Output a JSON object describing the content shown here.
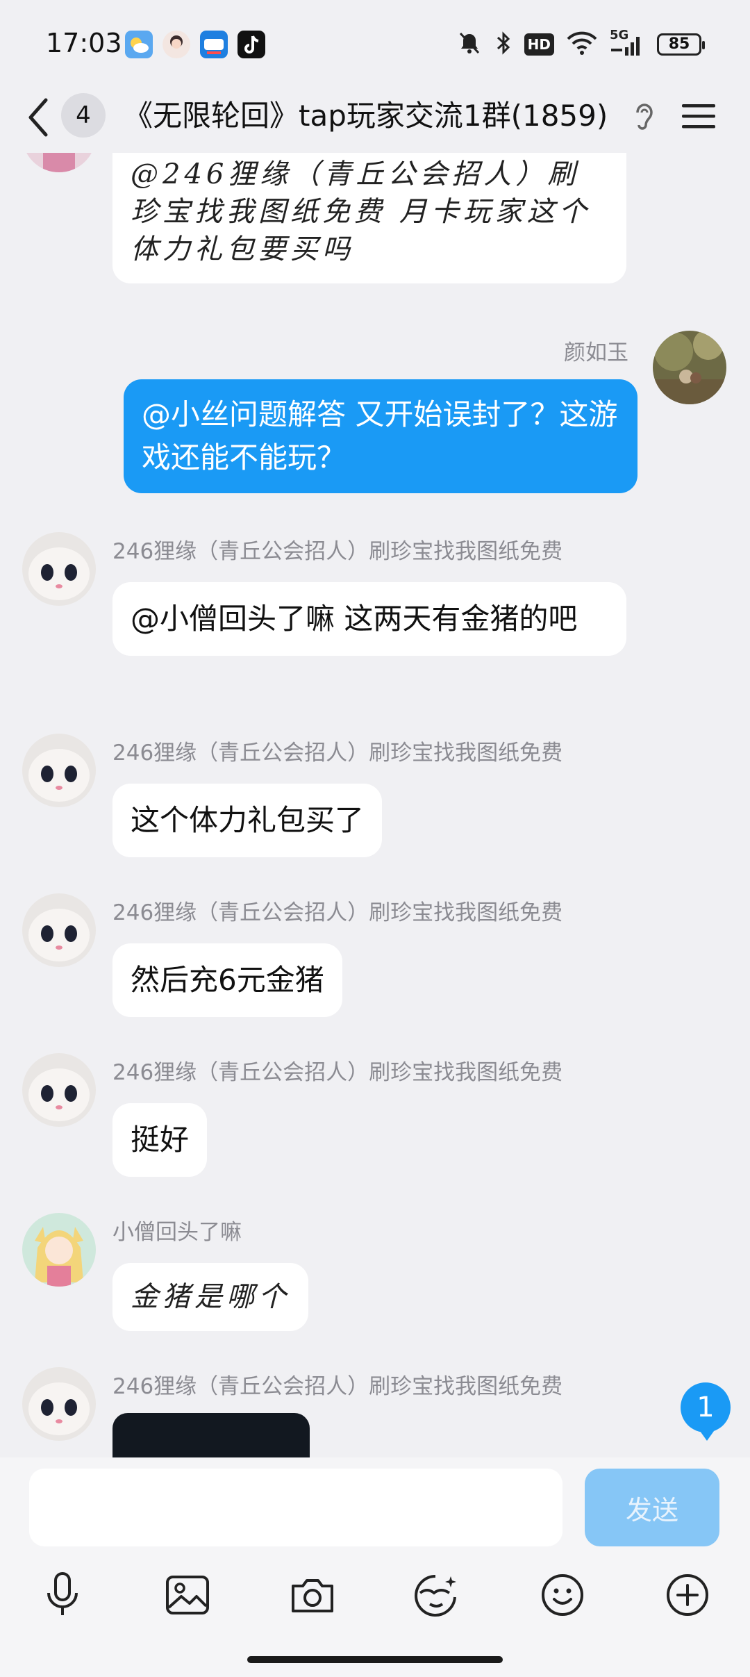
{
  "status_bar": {
    "time": "17:03",
    "battery": "85",
    "network": "5G",
    "hd": "HD",
    "icons": [
      "weather-app-icon",
      "avatar-app-icon",
      "browser-app-icon",
      "tiktok-app-icon",
      "mute-icon",
      "bluetooth-icon",
      "hd-icon",
      "wifi-icon",
      "signal-icon",
      "battery-icon"
    ]
  },
  "header": {
    "unread_count": "4",
    "title": "《无限轮回》tap玩家交流1群(1859)"
  },
  "messages": [
    {
      "sender": "",
      "text": "@246狸缘（青丘公会招人）刷珍宝找我图纸免费 月卡玩家这个体力礼包要买吗",
      "style": "script",
      "mine": false
    },
    {
      "sender": "颜如玉",
      "text": "@小丝问题解答 又开始误封了？这游戏还能不能玩？",
      "mine": true
    },
    {
      "sender": "246狸缘（青丘公会招人）刷珍宝找我图纸免费",
      "text": "@小僧回头了嘛 这两天有金猪的吧",
      "mine": false
    },
    {
      "sender": "246狸缘（青丘公会招人）刷珍宝找我图纸免费",
      "text": "这个体力礼包买了",
      "mine": false
    },
    {
      "sender": "246狸缘（青丘公会招人）刷珍宝找我图纸免费",
      "text": "然后充6元金猪",
      "mine": false
    },
    {
      "sender": "246狸缘（青丘公会招人）刷珍宝找我图纸免费",
      "text": "挺好",
      "mine": false
    },
    {
      "sender": "小僧回头了嘛",
      "text": "金猪是哪个",
      "style": "script",
      "mine": false
    },
    {
      "sender": "246狸缘（青丘公会招人）刷珍宝找我图纸免费",
      "text": "",
      "mine": false,
      "type": "image"
    }
  ],
  "new_message_count": "1",
  "input": {
    "value": "",
    "placeholder": "",
    "send_label": "发送"
  },
  "toolbar": [
    "mic-icon",
    "image-icon",
    "camera-icon",
    "sticker-icon",
    "emoji-icon",
    "plus-icon"
  ],
  "colors": {
    "accent": "#1a9af5",
    "background": "#f0f0f3",
    "send_disabled": "#86c6f6"
  }
}
